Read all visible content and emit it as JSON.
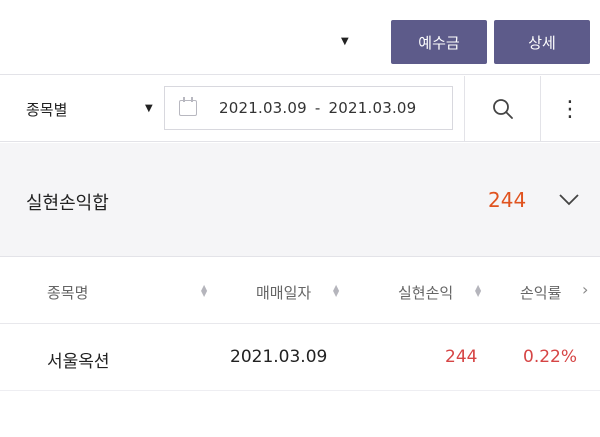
{
  "toolbar": {
    "dropdown_arrow": "▼",
    "deposit_button": "예수금",
    "detail_button": "상세"
  },
  "filter": {
    "mode_label": "종목별",
    "mode_arrow": "▼",
    "date_from": "2021.03.09",
    "date_separator": "-",
    "date_to": "2021.03.09",
    "more_icon": "⋮"
  },
  "summary": {
    "label": "실현손익합",
    "value": "244"
  },
  "table": {
    "columns": [
      "종목명",
      "매매일자",
      "실현손익",
      "손익률"
    ],
    "rows": [
      {
        "name": "서울옥션",
        "date": "2021.03.09",
        "pnl": "244",
        "rate": "0.22%"
      }
    ],
    "scroll_arrow": "›"
  },
  "colors": {
    "button_bg": "#5d5b8a",
    "profit": "#d64545",
    "summary_value": "#e0531f"
  },
  "icons": {
    "calendar": "calendar-icon",
    "search": "search-icon",
    "more": "more-vertical-icon",
    "toggle": "chevron-down-icon"
  }
}
